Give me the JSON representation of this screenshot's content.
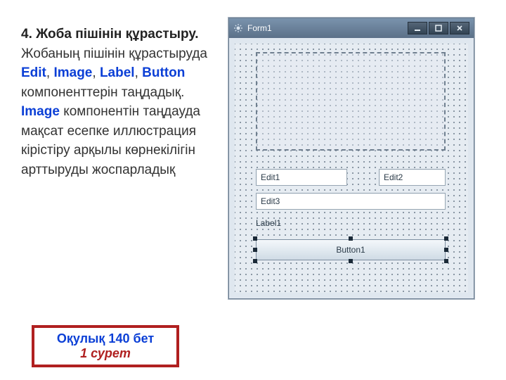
{
  "text": {
    "heading_bold": "4. Жоба пішінін құрастыру.",
    "p1_a": " Жобаның пішінін құрастыруда ",
    "comp_edit": "Edit",
    "sep": ", ",
    "comp_image": "Image",
    "comp_label": "Label",
    "comp_button": "Button",
    "p1_b": " компоненттерін таңдадық. ",
    "p2_highlight": "Image",
    "p2_rest": " компонентін таңдауда мақсат есепке иллюстрация кірістіру арқылы көрнекілігін арттыруды жоспарладық"
  },
  "callout": {
    "line1": "Оқулық 140 бет",
    "line2": "1 сурет"
  },
  "form": {
    "title": "Form1",
    "edit1": "Edit1",
    "edit2": "Edit2",
    "edit3": "Edit3",
    "label1": "Label1",
    "button1": "Button1"
  }
}
